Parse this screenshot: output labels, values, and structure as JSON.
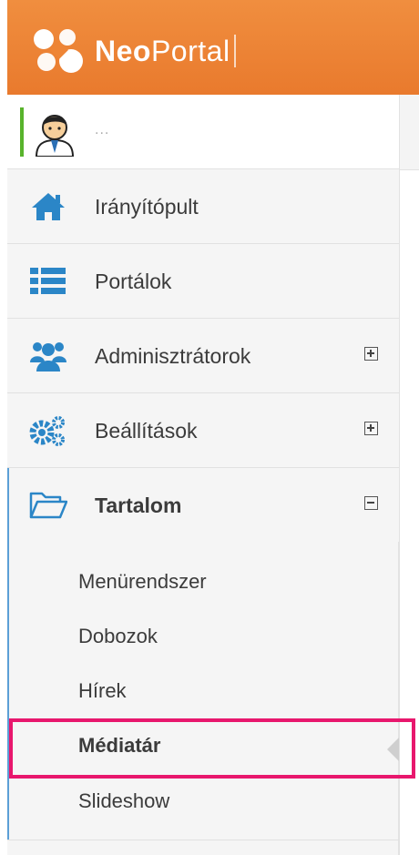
{
  "header": {
    "brand_bold": "Neo",
    "brand_regular": "Portal"
  },
  "user": {
    "name": "..."
  },
  "nav": {
    "dashboard": "Irányítópult",
    "portals": "Portálok",
    "admins": "Adminisztrátorok",
    "settings": "Beállítások",
    "content": "Tartalom"
  },
  "submenu": {
    "menu_system": "Menürendszer",
    "boxes": "Dobozok",
    "news": "Hírek",
    "media": "Médiatár",
    "slideshow": "Slideshow"
  },
  "colors": {
    "header": "#ee8536",
    "icon": "#2b86c7",
    "highlight": "#e8176d",
    "user_accent": "#58b32c"
  },
  "icons": {
    "logo": "cloud-blob-logo",
    "dashboard": "home-icon",
    "portals": "list-icon",
    "admins": "users-icon",
    "settings": "cogs-icon",
    "content": "folder-open-icon"
  }
}
